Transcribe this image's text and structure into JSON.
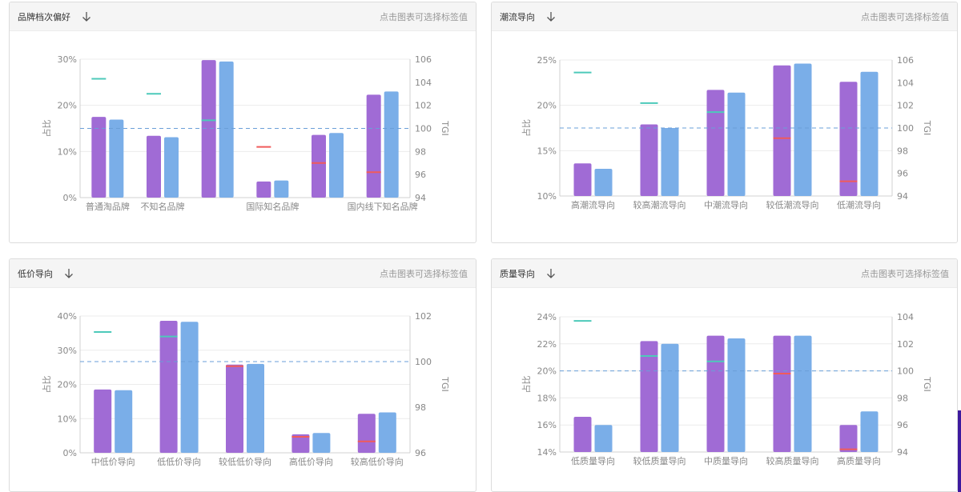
{
  "hint_text": "点击图表可选择标签值",
  "colors": {
    "purple": "#a06bd5",
    "blue": "#7aaee8",
    "tgi_high": "#4dcaba",
    "tgi_low": "#f05b5b",
    "ref_line": "#6a9fd8",
    "grid": "#ececec"
  },
  "panels": [
    {
      "title": "品牌档次偏好",
      "chart_data": {
        "type": "bar",
        "categories": [
          "普通淘品牌",
          "不知名品牌",
          "",
          "国际知名品牌",
          "",
          "国内线下知名品牌"
        ],
        "series": [
          {
            "values": [
              17.5,
              13.4,
              29.8,
              3.5,
              13.6,
              22.3
            ]
          },
          {
            "values": [
              16.9,
              13.1,
              29.5,
              3.7,
              14.0,
              23.0
            ]
          }
        ],
        "tgi": [
          104.3,
          103.0,
          100.7,
          98.4,
          97.0,
          96.2
        ],
        "ylim": [
          0,
          30
        ],
        "y_ticks": [
          "0%",
          "10%",
          "20%",
          "30%"
        ],
        "y_tick_values": [
          0,
          10,
          20,
          30
        ],
        "tgi_lim": [
          94,
          106
        ],
        "tgi_ticks": [
          "94",
          "96",
          "98",
          "100",
          "102",
          "104",
          "106"
        ],
        "tgi_tick_values": [
          94,
          96,
          98,
          100,
          102,
          104,
          106
        ],
        "tgi_ref": 100,
        "ylabel": "占比",
        "y2label": "TGI"
      }
    },
    {
      "title": "潮流导向",
      "chart_data": {
        "type": "bar",
        "categories": [
          "高潮流导向",
          "较高潮流导向",
          "中潮流导向",
          "较低潮流导向",
          "低潮流导向"
        ],
        "series": [
          {
            "values": [
              13.6,
              17.9,
              21.7,
              24.4,
              22.6
            ]
          },
          {
            "values": [
              13.0,
              17.5,
              21.4,
              24.6,
              23.7
            ]
          }
        ],
        "tgi": [
          104.9,
          102.2,
          101.4,
          99.1,
          95.3
        ],
        "ylim": [
          10,
          25
        ],
        "y_ticks": [
          "10%",
          "15%",
          "20%",
          "25%"
        ],
        "y_tick_values": [
          10,
          15,
          20,
          25
        ],
        "tgi_lim": [
          94,
          106
        ],
        "tgi_ticks": [
          "94",
          "96",
          "98",
          "100",
          "102",
          "104",
          "106"
        ],
        "tgi_tick_values": [
          94,
          96,
          98,
          100,
          102,
          104,
          106
        ],
        "tgi_ref": 100,
        "ylabel": "占比",
        "y2label": "TGI"
      }
    },
    {
      "title": "低价导向",
      "chart_data": {
        "type": "bar",
        "categories": [
          "中低价导向",
          "低低价导向",
          "较低低价导向",
          "高低价导向",
          "较高低价导向"
        ],
        "series": [
          {
            "values": [
              18.5,
              38.6,
              25.8,
              5.4,
              11.4
            ]
          },
          {
            "values": [
              18.3,
              38.3,
              26.0,
              5.8,
              11.8
            ]
          }
        ],
        "tgi": [
          101.3,
          101.1,
          99.8,
          96.7,
          96.5
        ],
        "ylim": [
          0,
          40
        ],
        "y_ticks": [
          "0%",
          "10%",
          "20%",
          "30%",
          "40%"
        ],
        "y_tick_values": [
          0,
          10,
          20,
          30,
          40
        ],
        "tgi_lim": [
          96,
          102
        ],
        "tgi_ticks": [
          "96",
          "98",
          "100",
          "102"
        ],
        "tgi_tick_values": [
          96,
          98,
          100,
          102
        ],
        "tgi_ref": 100,
        "ylabel": "占比",
        "y2label": "TGI"
      }
    },
    {
      "title": "质量导向",
      "chart_data": {
        "type": "bar",
        "categories": [
          "低质量导向",
          "较低质量导向",
          "中质量导向",
          "较高质量导向",
          "高质量导向"
        ],
        "series": [
          {
            "values": [
              16.6,
              22.2,
              22.6,
              22.6,
              16.0
            ]
          },
          {
            "values": [
              16.0,
              22.0,
              22.4,
              22.6,
              17.0
            ]
          }
        ],
        "tgi": [
          103.7,
          101.1,
          100.7,
          99.8,
          94.2
        ],
        "ylim": [
          14,
          24
        ],
        "y_ticks": [
          "14%",
          "16%",
          "18%",
          "20%",
          "22%",
          "24%"
        ],
        "y_tick_values": [
          14,
          16,
          18,
          20,
          22,
          24
        ],
        "tgi_lim": [
          94,
          104
        ],
        "tgi_ticks": [
          "94",
          "96",
          "98",
          "100",
          "102",
          "104"
        ],
        "tgi_tick_values": [
          94,
          96,
          98,
          100,
          102,
          104
        ],
        "tgi_ref": 100,
        "ylabel": "占比",
        "y2label": "TGI"
      }
    }
  ]
}
